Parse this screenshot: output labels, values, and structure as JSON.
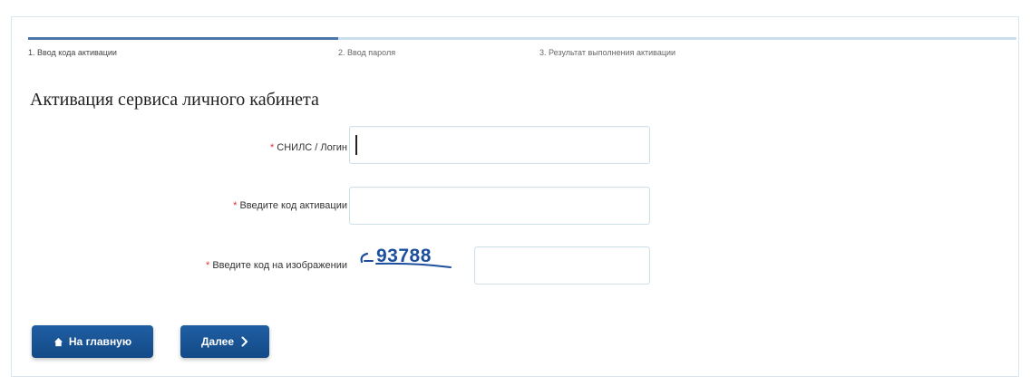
{
  "stepper": {
    "steps": [
      {
        "label": "1. Ввод кода активации",
        "active": true
      },
      {
        "label": "2. Ввод пароля",
        "active": false
      },
      {
        "label": "3. Результат выполнения активации",
        "active": false
      }
    ]
  },
  "page": {
    "title": "Активация сервиса личного кабинета"
  },
  "form": {
    "required_mark": "*",
    "snils": {
      "label": "СНИЛС / Логин",
      "value": ""
    },
    "activation_code": {
      "label": "Введите код активации",
      "value": ""
    },
    "captcha": {
      "label": "Введите код на изображении",
      "image_text": "93788",
      "value": ""
    }
  },
  "buttons": {
    "home": {
      "label": "На главную",
      "icon": "home-icon"
    },
    "next": {
      "label": "Далее",
      "icon": "chevron-right-icon"
    }
  },
  "colors": {
    "primary_button": "#1f5ea3",
    "active_step": "#4a77a8",
    "inactive_step": "#c9dfee",
    "required": "#e03030",
    "captcha_ink": "#1d4f9c"
  }
}
